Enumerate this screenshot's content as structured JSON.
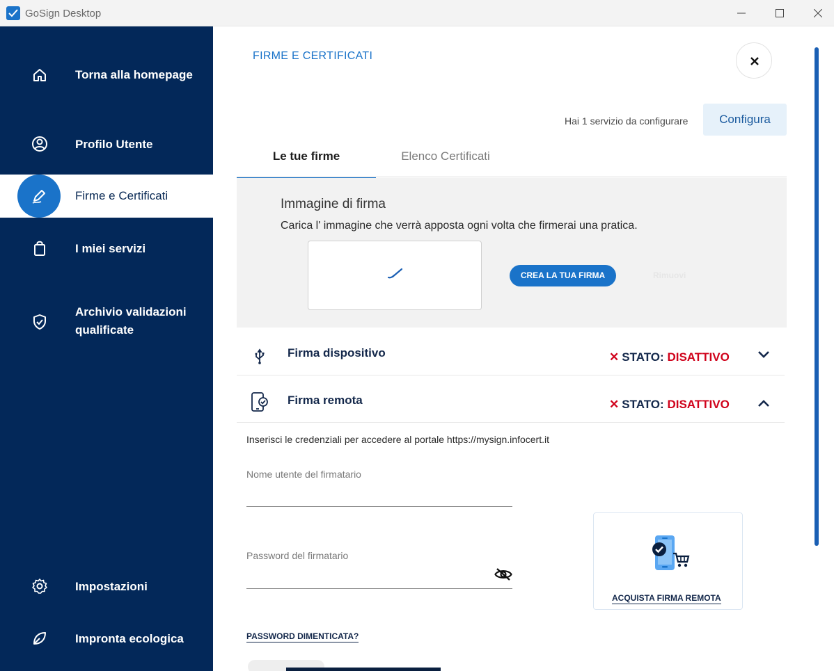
{
  "window": {
    "title": "GoSign Desktop"
  },
  "sidebar": {
    "items": [
      {
        "label": "Torna alla homepage",
        "icon": "home-icon"
      },
      {
        "label": "Profilo Utente",
        "icon": "user-circle-icon"
      },
      {
        "label": "Firme e Certificati",
        "icon": "pen-signature-icon",
        "active": true
      },
      {
        "label": "I miei servizi",
        "icon": "shopping-bag-icon"
      },
      {
        "label": "Archivio validazioni qualificate",
        "icon": "shield-check-icon"
      },
      {
        "label": "Impostazioni",
        "icon": "gear-icon"
      },
      {
        "label": "Impronta ecologica",
        "icon": "leaf-icon"
      }
    ]
  },
  "main": {
    "title": "FIRME E CERTIFICATI",
    "config_text": "Hai 1 servizio da configurare",
    "config_button": "Configura",
    "tabs": [
      {
        "label": "Le tue firme",
        "active": true
      },
      {
        "label": "Elenco Certificati",
        "active": false
      }
    ],
    "signature_image": {
      "title": "Immagine di firma",
      "description": "Carica l' immagine che verrà apposta ogni volta che firmerai una pratica.",
      "create_button": "CREA LA TUA FIRMA",
      "remove_button": "Rimuovi"
    },
    "accordions": [
      {
        "title": "Firma dispositivo",
        "status_label": "STATO:",
        "status_value": "DISATTIVO",
        "expanded": false
      },
      {
        "title": "Firma remota",
        "status_label": "STATO:",
        "status_value": "DISATTIVO",
        "expanded": true
      }
    ],
    "remote": {
      "credentials_text": "Inserisci le credenziali per accedere al portale https://mysign.infocert.it",
      "username_label": "Nome utente del firmatario",
      "password_label": "Password del firmatario",
      "forgot_password": "PASSWORD DIMENTICATA?",
      "buy_label": "ACQUISTA FIRMA REMOTA"
    }
  },
  "colors": {
    "sidebar_bg": "#032859",
    "accent": "#1a73c9",
    "status_red": "#d0021b"
  }
}
